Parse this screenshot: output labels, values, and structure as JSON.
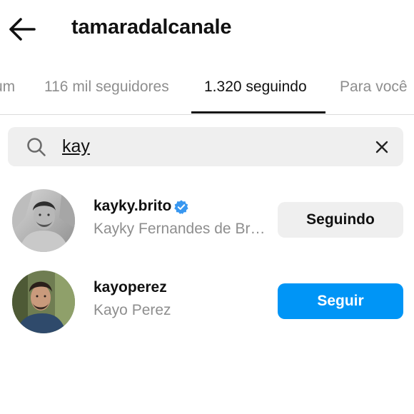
{
  "header": {
    "title": "tamaradalcanale"
  },
  "tabs": [
    {
      "label": "um"
    },
    {
      "label": "116 mil seguidores"
    },
    {
      "label": "1.320 seguindo"
    },
    {
      "label": "Para você"
    }
  ],
  "active_tab": "1.320 seguindo",
  "search": {
    "value": "kay"
  },
  "results": [
    {
      "username": "kayky.brito",
      "full_name": "Kayky Fernandes de Br…",
      "verified": true,
      "button_label": "Seguindo"
    },
    {
      "username": "kayoperez",
      "full_name": "Kayo Perez",
      "verified": false,
      "button_label": "Seguir"
    }
  ],
  "colors": {
    "accent": "#0095f6",
    "verified": "#3897f0",
    "muted_text": "#8e8e8e",
    "button_gray": "#efefef"
  }
}
